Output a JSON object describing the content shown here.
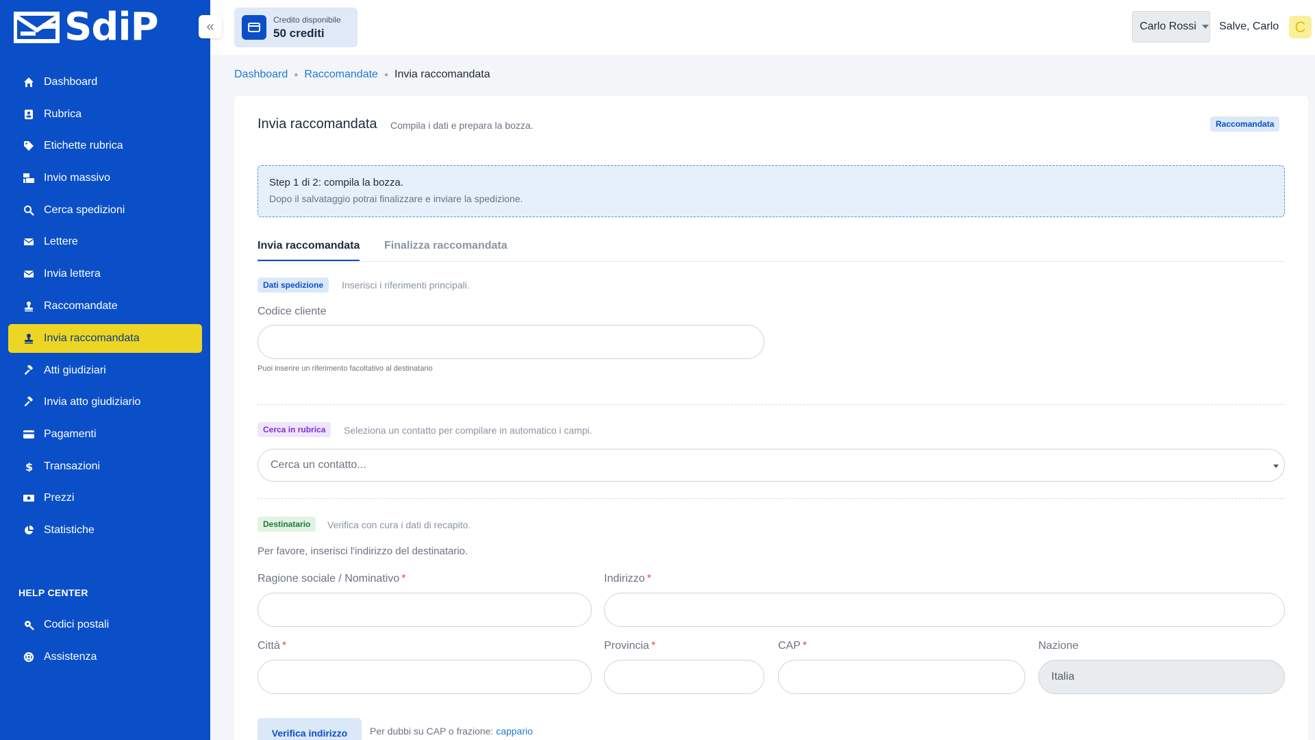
{
  "app": {
    "logo_text": "SdiP"
  },
  "sidebar": {
    "items": [
      {
        "label": "Dashboard",
        "icon": "home-icon"
      },
      {
        "label": "Rubrica",
        "icon": "address-book-icon"
      },
      {
        "label": "Etichette rubrica",
        "icon": "tag-icon"
      },
      {
        "label": "Invio massivo",
        "icon": "mail-bulk-icon"
      },
      {
        "label": "Cerca spedizioni",
        "icon": "search-icon"
      },
      {
        "label": "Lettere",
        "icon": "envelope-icon"
      },
      {
        "label": "Invia lettera",
        "icon": "envelope-icon"
      },
      {
        "label": "Raccomandate",
        "icon": "stamp-icon"
      },
      {
        "label": "Invia raccomandata",
        "icon": "stamp-icon"
      },
      {
        "label": "Atti giudiziari",
        "icon": "gavel-icon"
      },
      {
        "label": "Invia atto giudiziario",
        "icon": "gavel-icon"
      },
      {
        "label": "Pagamenti",
        "icon": "credit-card-icon"
      },
      {
        "label": "Transazioni",
        "icon": "dollar-icon"
      },
      {
        "label": "Prezzi",
        "icon": "money-icon"
      },
      {
        "label": "Statistiche",
        "icon": "pie-chart-icon"
      }
    ],
    "help_title": "HELP CENTER",
    "help_items": [
      {
        "label": "Codici postali",
        "icon": "search-location-icon"
      },
      {
        "label": "Assistenza",
        "icon": "lifebuoy-icon"
      }
    ]
  },
  "topbar": {
    "credit_label": "Credito disponibile",
    "credit_value": "50 crediti",
    "user_select": "Carlo Rossi",
    "greeting": "Salve, Carlo",
    "avatar_letter": "C"
  },
  "breadcrumb": {
    "items": [
      "Dashboard",
      "Raccomandate"
    ],
    "current": "Invia raccomandata"
  },
  "card": {
    "title": "Invia raccomandata",
    "subtitle": "Compila i dati e prepara la bozza.",
    "type_badge": "Raccomandata",
    "step_title": "Step 1 di 2: compila la bozza.",
    "step_sub": "Dopo il salvataggio potrai finalizzare e inviare la spedizione.",
    "tabs": [
      "Invia raccomandata",
      "Finalizza raccomandata"
    ]
  },
  "sections": {
    "shipment": {
      "badge": "Dati spedizione",
      "note": "Inserisci i riferimenti principali.",
      "customer_code_label": "Codice cliente",
      "customer_code_value": "",
      "customer_code_help": "Puoi inserire un riferimento facoltativo al destinatario"
    },
    "addressbook": {
      "badge": "Cerca in rubrica",
      "note": "Seleziona un contatto per compilare in automatico i campi.",
      "placeholder": "Cerca un contatto..."
    },
    "recipient": {
      "badge": "Destinatario",
      "note": "Verifica con cura i dati di recapito.",
      "intro": "Per favore, inserisci l'indirizzo del destinatario.",
      "name_label": "Ragione sociale / Nominativo",
      "address_label": "Indirizzo",
      "city_label": "Città",
      "province_label": "Provincia",
      "cap_label": "CAP",
      "country_label": "Nazione",
      "country_value": "Italia",
      "required_mark": "*"
    },
    "verify": {
      "button": "Verifica indirizzo",
      "note": "Per dubbi su CAP o frazione:",
      "link": "cappario"
    }
  },
  "colors": {
    "sidebar": "#0a4fc8",
    "active": "#ecd623",
    "accent": "#1e7ad6"
  }
}
